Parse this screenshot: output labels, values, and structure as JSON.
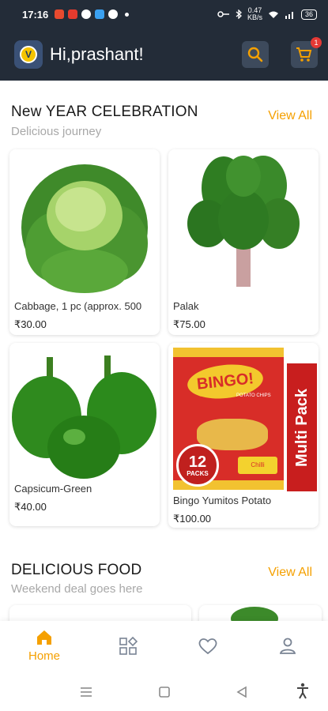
{
  "status_bar": {
    "time": "17:16",
    "battery": "36",
    "net_speed": "0.47\nKB/s"
  },
  "app_bar": {
    "greeting": "Hi,prashant!",
    "cart_count": "1"
  },
  "sections": [
    {
      "title": "New YEAR CELEBRATION",
      "subtitle": "Delicious journey",
      "view_all": "View All",
      "products": [
        {
          "name": "Cabbage, 1 pc (approx. 500",
          "price": "₹30.00"
        },
        {
          "name": "Palak",
          "price": "₹75.00"
        },
        {
          "name": "Capsicum-Green",
          "price": "₹40.00"
        },
        {
          "name": "Bingo Yumitos Potato",
          "price": "₹100.00",
          "pack_text": "Multi Pack",
          "brand": "BINGO!",
          "packs": "12",
          "packs_label": "PACKS",
          "flavour": "Chilli",
          "logo_text": "POTATO CHIPS"
        }
      ]
    },
    {
      "title": "DELICIOUS FOOD",
      "subtitle": "Weekend deal goes here",
      "view_all": "View All"
    }
  ],
  "bottom_nav": [
    {
      "label": "Home",
      "icon": "home-icon",
      "active": true
    },
    {
      "label": "",
      "icon": "categories-icon",
      "active": false
    },
    {
      "label": "",
      "icon": "heart-icon",
      "active": false
    },
    {
      "label": "",
      "icon": "profile-icon",
      "active": false
    }
  ],
  "colors": {
    "header_bg": "#232c38",
    "accent": "#f5a000",
    "badge": "#e53935"
  }
}
